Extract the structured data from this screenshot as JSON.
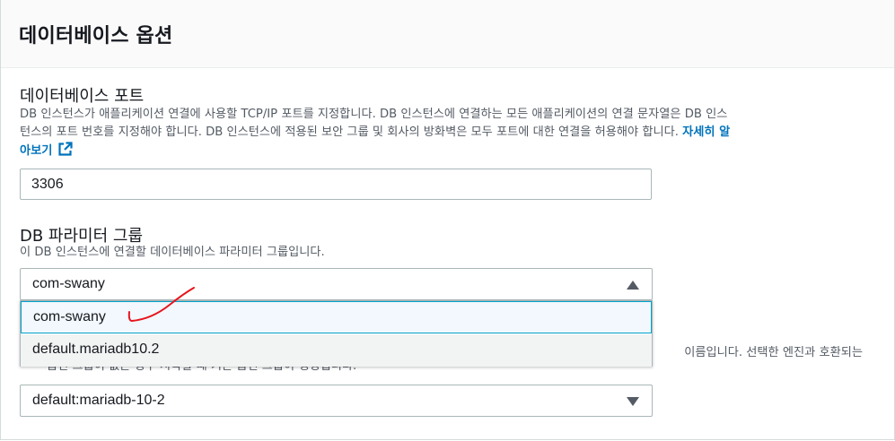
{
  "section": {
    "title": "데이터베이스 옵션"
  },
  "port": {
    "label": "데이터베이스 포트",
    "description_line1": "DB 인스턴스가 애플리케이션 연결에 사용할 TCP/IP 포트를 지정합니다. DB 인스턴스에 연결하는 모든 애플리케이션의 연결 문자열은 DB 인스",
    "description_line2": "턴스의 포트 번호를 지정해야 합니다. DB 인스턴스에 적용된 보안 그룹 및 회사의 방화벽은 모두 포트에 대한 연결을 허용해야 합니다.",
    "learn_more_part1": "자세히 알",
    "learn_more_part2": "아보기",
    "value": "3306"
  },
  "param_group": {
    "label": "DB 파라미터 그룹",
    "description": "이 DB 인스턴스에 연결할 데이터베이스 파라미터 그룹입니다.",
    "selected": "com-swany",
    "options": [
      "com-swany",
      "default.mariadb10.2"
    ]
  },
  "option_group": {
    "description_visible_line1": "이름입니다. 선택한 엔진과 호환되는",
    "description_visible_line2": "옵션 그룹이 없는 경우 시작할 때 기본 옵션 그룹이 생성됩니다.",
    "selected": "default:mariadb-10-2"
  },
  "icons": {
    "external_link": "external-link-icon",
    "caret_up": "caret-up-icon",
    "caret_down": "caret-down-icon"
  },
  "colors": {
    "link": "#0073bb",
    "annotation": "#e8141c",
    "focused_option_border": "#00a1c9"
  }
}
